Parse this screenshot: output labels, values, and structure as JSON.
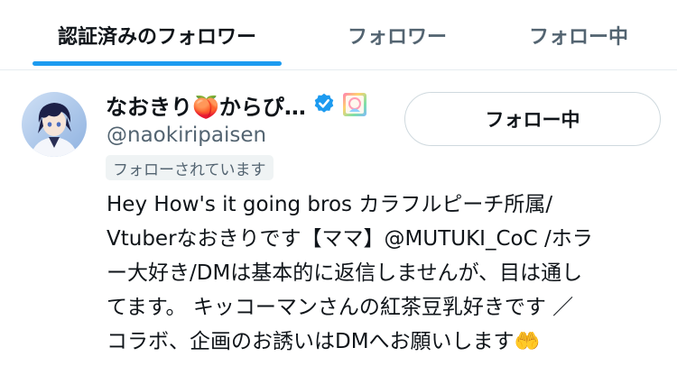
{
  "tabs": [
    {
      "label": "認証済みのフォロワー",
      "active": true
    },
    {
      "label": "フォロワー",
      "active": false
    },
    {
      "label": "フォロー中",
      "active": false
    }
  ],
  "user": {
    "name": "なおきり🍑からぴ…",
    "handle": "@naokiripaisen",
    "follows_you": "フォローされています",
    "follow_button": "フォロー中",
    "bio_lines": [
      "Hey How's it going bros カラフルピーチ所属/",
      "Vtuberなおきりです【ママ】@MUTUKI_CoC /ホラ",
      "ー大好き/DMは基本的に返信しませんが、目は通し",
      "てます。 キッコーマンさんの紅茶豆乳好きです ／",
      "コラボ、企画のお誘いはDMへお願いします🤲"
    ],
    "badges": [
      "verified-badge-icon",
      "affiliate-badge-icon"
    ]
  },
  "colors": {
    "accent": "#1d9bf0",
    "muted": "#536471",
    "text": "#0f1419"
  }
}
